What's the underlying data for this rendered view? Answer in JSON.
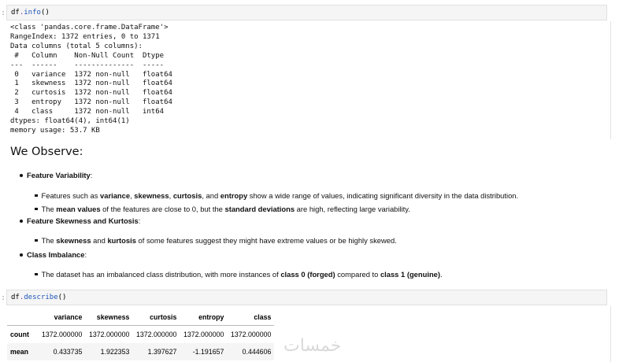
{
  "prompt_marker": ":",
  "cell1": {
    "code_object": "df",
    "code_dot": ".",
    "code_method": "info",
    "code_parens": "()"
  },
  "info_output": "<class 'pandas.core.frame.DataFrame'>\nRangeIndex: 1372 entries, 0 to 1371\nData columns (total 5 columns):\n #   Column    Non-Null Count  Dtype  \n---  ------    --------------  -----  \n 0   variance  1372 non-null   float64\n 1   skewness  1372 non-null   float64\n 2   curtosis  1372 non-null   float64\n 3   entropy   1372 non-null   float64\n 4   class     1372 non-null   int64  \ndtypes: float64(4), int64(1)\nmemory usage: 53.7 KB",
  "markdown": {
    "heading": "We Observe:",
    "variability": {
      "title": "Feature Variability",
      "suffix": ":",
      "bullet1": {
        "t1": "Features such as ",
        "b1": "variance",
        "t2": ", ",
        "b2": "skewness",
        "t3": ", ",
        "b3": "curtosis",
        "t4": ", and ",
        "b4": "entropy",
        "t5": " show a wide range of values, indicating significant diversity in the data distribution."
      },
      "bullet2": {
        "t1": "The ",
        "b1": "mean values",
        "t2": " of the features are close to 0, but the ",
        "b2": "standard deviations",
        "t3": " are high, reflecting large variability."
      }
    },
    "skew": {
      "title": "Feature Skewness and Kurtosis",
      "suffix": ":",
      "bullet1": {
        "t1": "The ",
        "b1": "skewness",
        "t2": " and ",
        "b2": "kurtosis",
        "t3": " of some features suggest they might have extreme values or be highly skewed."
      }
    },
    "imbalance": {
      "title": "Class Imbalance",
      "suffix": ":",
      "bullet1": {
        "t1": "The dataset has an imbalanced class distribution, with more instances of ",
        "b1": "class 0 (forged)",
        "t2": " compared to ",
        "b2": "class 1 (genuine)",
        "t3": "."
      }
    }
  },
  "cell2": {
    "code_object": "df",
    "code_dot": ".",
    "code_method": "describe",
    "code_parens": "()"
  },
  "describe_table": {
    "columns": [
      "",
      "variance",
      "skewness",
      "curtosis",
      "entropy",
      "class"
    ],
    "rows": [
      [
        "count",
        "1372.000000",
        "1372.000000",
        "1372.000000",
        "1372.000000",
        "1372.000000"
      ],
      [
        "mean",
        "0.433735",
        "1.922353",
        "1.397627",
        "-1.191657",
        "0.444606"
      ]
    ]
  },
  "watermark": "خمسات"
}
